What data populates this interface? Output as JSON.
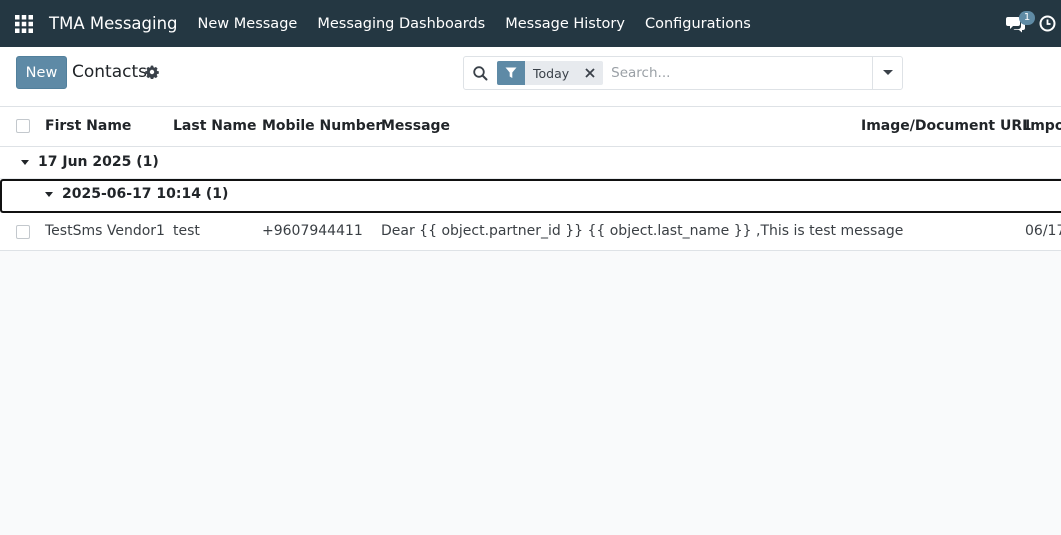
{
  "navbar": {
    "brand": "TMA Messaging",
    "menu": [
      "New Message",
      "Messaging Dashboards",
      "Message History",
      "Configurations"
    ],
    "chat_count": "1"
  },
  "control": {
    "new_label": "New",
    "breadcrumb": "Contacts",
    "facet_label": "Today",
    "search_placeholder": "Search..."
  },
  "table": {
    "columns": [
      "First Name",
      "Last Name",
      "Mobile Number",
      "Message",
      "Image/Document URL",
      "Impor"
    ],
    "group": "17 Jun 2025 (1)",
    "subgroup": "2025-06-17 10:14 (1)",
    "rows": [
      {
        "first_name": "TestSms Vendor1",
        "last_name": "test",
        "mobile": "+9607944411",
        "message": "Dear {{ object.partner_id }} {{ object.last_name }} ,This is test message",
        "image_url": "",
        "import": "06/17"
      }
    ]
  },
  "colors": {
    "navbar": "#243742",
    "primary": "#5e8aa6"
  }
}
